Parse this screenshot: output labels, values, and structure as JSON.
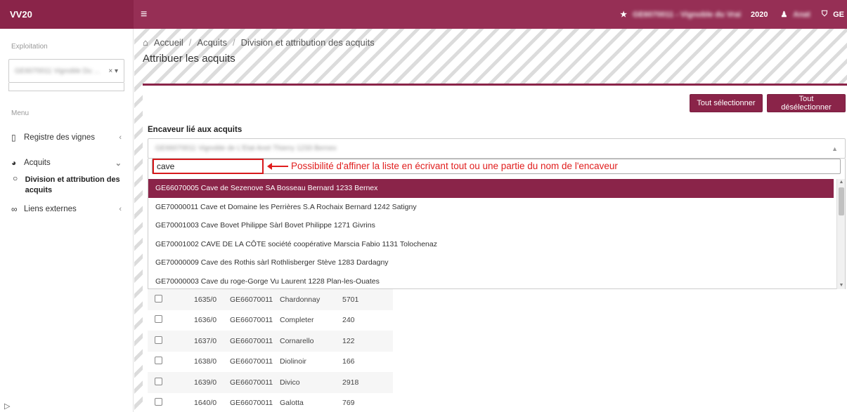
{
  "app": {
    "brand": "VV20",
    "year": "2020",
    "user_blurred": "Anat",
    "exploitation_blurred": "GE6070011 - Vignoble du Vrai",
    "extra_label": "GE",
    "accent_color": "#8a2449"
  },
  "sidebar": {
    "exploitation_label": "Exploitation",
    "exploitation_value_blurred": "GE6070011 Vignoble Du ...",
    "exploitation_clear": "×",
    "exploitation_caret": "▾",
    "menu_label": "Menu",
    "items": [
      {
        "label": "Registre des vignes",
        "icon": "map-icon",
        "glyph": "▯",
        "chevron": "‹"
      },
      {
        "label": "Acquits",
        "icon": "gauge-icon",
        "glyph": "◕",
        "chevron": "⌄"
      },
      {
        "label": "Liens externes",
        "icon": "link-icon",
        "glyph": "∞",
        "chevron": "‹"
      }
    ],
    "sub_items": [
      {
        "label": "Division et attribution des acquits",
        "glyph": "○"
      }
    ]
  },
  "breadcrumb": {
    "home_glyph": "⌂",
    "items": [
      "Accueil",
      "Acquits",
      "Division et attribution des acquits"
    ]
  },
  "page": {
    "title": "Attribuer les acquits",
    "select_all": "Tout sélectionner",
    "deselect_all": "Tout désélectionner",
    "encaveur_label": "Encaveur lié aux acquits",
    "encaveur_selected_blurred": "GE66070011 Vignoble de L'Etat Anet Thierry 1233 Bernex",
    "search_value": "cave",
    "annotation": "Possibilité d'affiner la liste en écrivant tout ou une partie du nom de l'encaveur",
    "options": [
      "GE66070005 Cave de Sezenove SA Bosseau Bernard 1233 Bernex",
      "GE70000011 Cave et Domaine les Perrières S.A Rochaix Bernard 1242 Satigny",
      "GE70001003 Cave Bovet Philippe Sàrl Bovet Philippe 1271 Givrins",
      "GE70001002 CAVE DE LA CÔTE société coopérative Marscia Fabio 1131 Tolochenaz",
      "GE70000009 Cave des Rothis sàrl Rothlisberger Stève 1283 Dardagny",
      "GE70000003 Cave du roge-Gorge Vu Laurent 1228 Plan-les-Ouates"
    ],
    "rows": [
      {
        "no": "1635/0",
        "code": "GE66070011",
        "cepage": "Chardonnay",
        "value": "5701"
      },
      {
        "no": "1636/0",
        "code": "GE66070011",
        "cepage": "Completer",
        "value": "240"
      },
      {
        "no": "1637/0",
        "code": "GE66070011",
        "cepage": "Cornarello",
        "value": "122"
      },
      {
        "no": "1638/0",
        "code": "GE66070011",
        "cepage": "Diolinoir",
        "value": "166"
      },
      {
        "no": "1639/0",
        "code": "GE66070011",
        "cepage": "Divico",
        "value": "2918"
      },
      {
        "no": "1640/0",
        "code": "GE66070011",
        "cepage": "Galotta",
        "value": "769"
      }
    ]
  }
}
